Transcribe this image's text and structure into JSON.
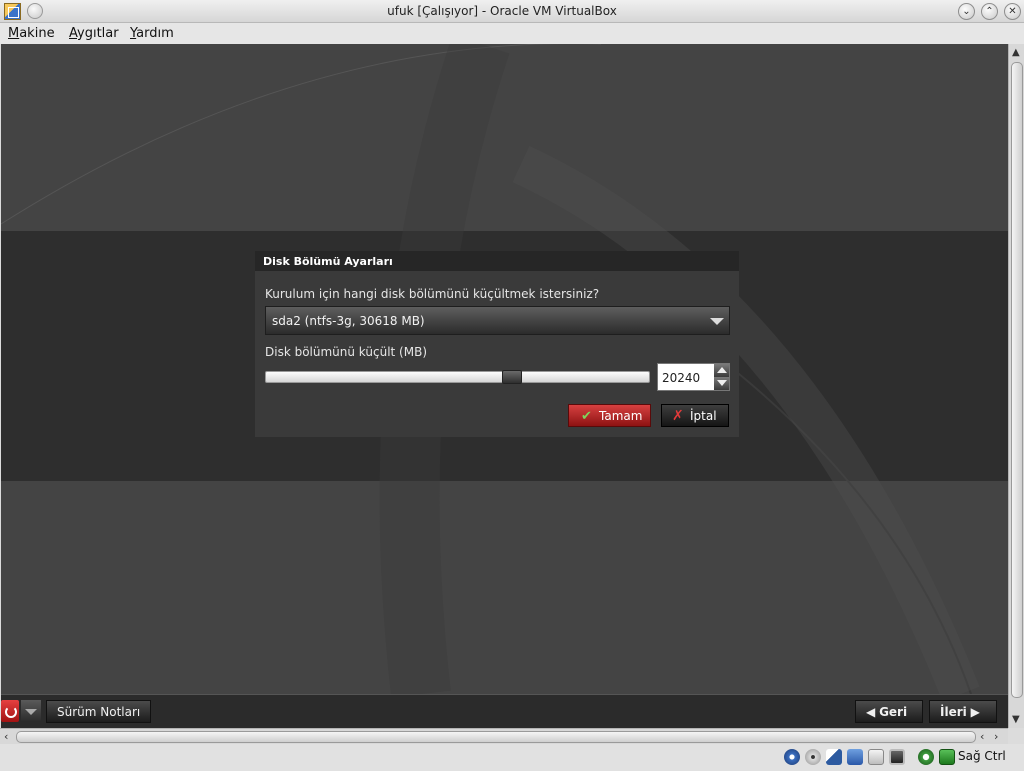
{
  "window": {
    "title": "ufuk [Çalışıyor] - Oracle VM VirtualBox"
  },
  "menubar": {
    "items": [
      {
        "label_u": "M",
        "label_rest": "akine"
      },
      {
        "label_u": "A",
        "label_rest": "ygıtlar"
      },
      {
        "label_u": "Y",
        "label_rest": "ardım"
      }
    ]
  },
  "dialog": {
    "title": "Disk Bölümü Ayarları",
    "question": "Kurulum için hangi disk bölümünü küçültmek istersiniz?",
    "partition_selected": "sda2 (ntfs-3g, 30618 MB)",
    "shrink_label": "Disk bölümünü küçült (MB)",
    "shrink_value": "20240",
    "slider_fraction": 0.65,
    "ok_label": "Tamam",
    "cancel_label": "İptal"
  },
  "vm_toolbar": {
    "release_notes_label": "Sürüm Notları",
    "back_label": "Geri",
    "next_label": "İleri"
  },
  "statusbar": {
    "host_key": "Sağ Ctrl",
    "icons": [
      "hard-disk-icon",
      "optical-drive-icon",
      "usb-icon",
      "network-icon",
      "shared-folder-icon",
      "cpu-virtualization-icon",
      "mouse-integration-icon",
      "keyboard-capture-icon"
    ]
  },
  "colors": {
    "ok_button": "#b82222",
    "dialog_bg": "#3a3a3a",
    "vm_bg": "#444444"
  }
}
